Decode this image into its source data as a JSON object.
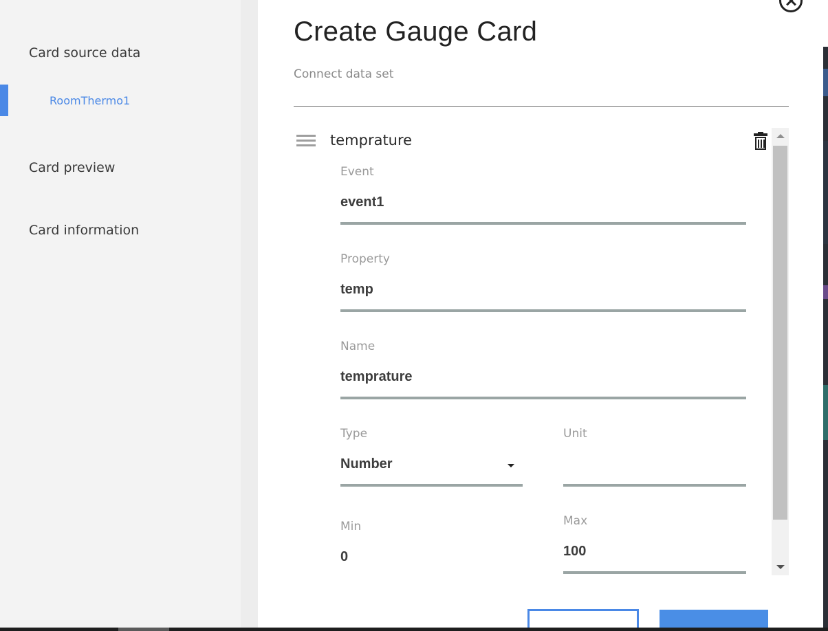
{
  "sidebar": {
    "items": [
      {
        "label": "Card source data"
      },
      {
        "label": "RoomThermo1"
      },
      {
        "label": "Card preview"
      },
      {
        "label": "Card information"
      }
    ]
  },
  "dialog": {
    "title": "Create Gauge Card",
    "subtitle": "Connect data set"
  },
  "dataset": {
    "name": "temprature",
    "fields": {
      "event": {
        "label": "Event",
        "value": "event1"
      },
      "property": {
        "label": "Property",
        "value": "temp"
      },
      "name": {
        "label": "Name",
        "value": "temprature"
      },
      "type": {
        "label": "Type",
        "value": "Number"
      },
      "unit": {
        "label": "Unit",
        "value": ""
      },
      "min": {
        "label": "Min",
        "value": "0"
      },
      "max": {
        "label": "Max",
        "value": "100"
      }
    }
  },
  "icons": {
    "close": "close-icon",
    "drag": "drag-handle-icon",
    "delete": "trash-icon",
    "dropdown": "caret-down-icon"
  },
  "colors": {
    "accent": "#4a88e6",
    "field_underline": "#9aa5a4",
    "sidebar_bg": "#f3f3f3"
  }
}
